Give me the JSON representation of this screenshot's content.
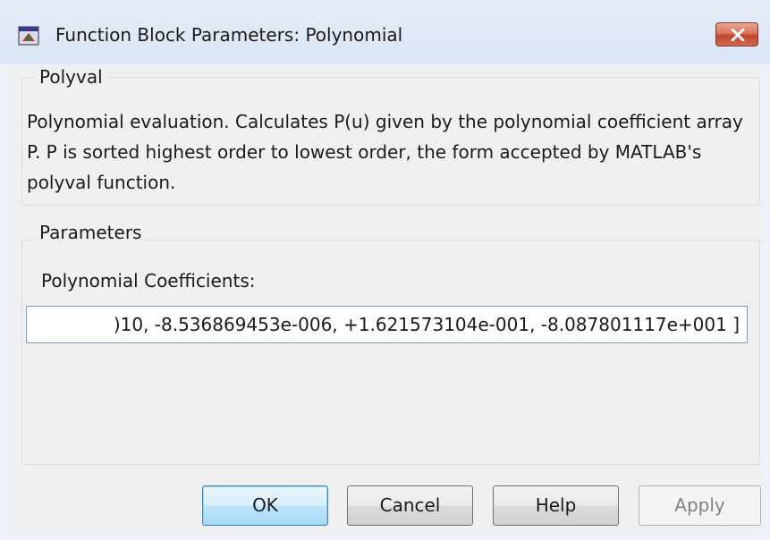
{
  "window": {
    "title": "Function Block Parameters: Polynomial",
    "icon": "simulink-block-icon",
    "close_icon": "close-icon"
  },
  "polyval": {
    "legend": "Polyval",
    "description": "Polynomial evaluation.  Calculates P(u) given by the polynomial coefficient array P. P is sorted highest order to lowest order, the form accepted by MATLAB's polyval function."
  },
  "parameters": {
    "legend": "Parameters",
    "coefficients_label": "Polynomial Coefficients:",
    "coefficients_value": ")10, -8.536869453e-006, +1.621573104e-001, -8.087801117e+001 ]"
  },
  "buttons": {
    "ok": "OK",
    "cancel": "Cancel",
    "help": "Help",
    "apply": "Apply"
  },
  "colors": {
    "close_button": "#c7432c",
    "default_button_border": "#3c7fb1",
    "input_border": "#7a9ccc"
  }
}
